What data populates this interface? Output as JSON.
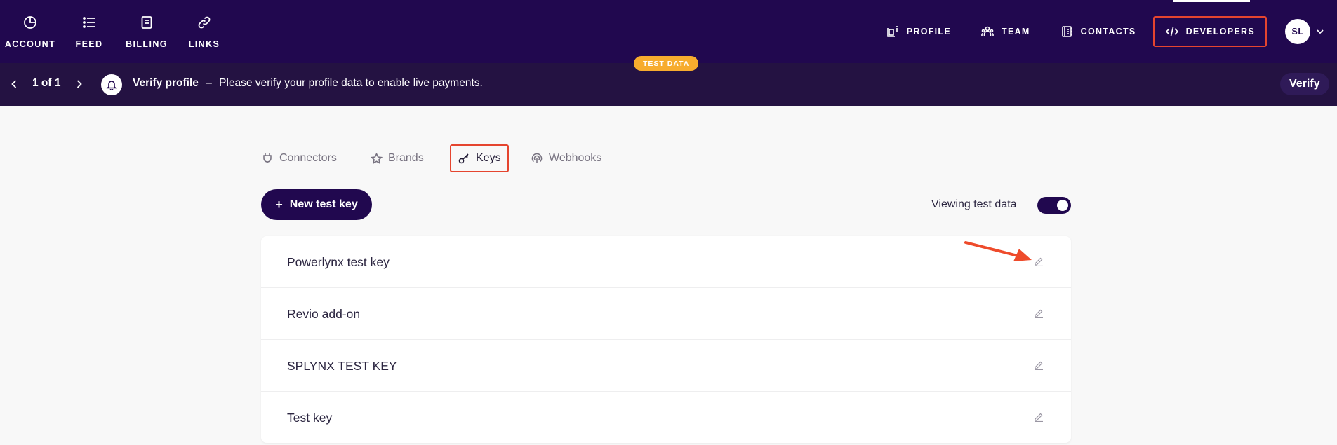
{
  "nav": {
    "left": [
      {
        "label": "ACCOUNT",
        "icon": "pie-chart-icon"
      },
      {
        "label": "FEED",
        "icon": "list-icon"
      },
      {
        "label": "BILLING",
        "icon": "document-icon"
      },
      {
        "label": "LINKS",
        "icon": "link-icon"
      }
    ],
    "right": [
      {
        "label": "PROFILE",
        "icon": "profile-card-icon"
      },
      {
        "label": "TEAM",
        "icon": "team-icon"
      },
      {
        "label": "CONTACTS",
        "icon": "contacts-book-icon"
      },
      {
        "label": "DEVELOPERS",
        "icon": "code-icon"
      }
    ],
    "avatar_initials": "SL"
  },
  "notification": {
    "badge": "TEST DATA",
    "pager": "1 of 1",
    "title": "Verify profile",
    "separator": "–",
    "message": "Please verify your profile data to enable live payments.",
    "verify_label": "Verify"
  },
  "tabs": [
    {
      "label": "Connectors",
      "icon": "plug-icon"
    },
    {
      "label": "Brands",
      "icon": "star-icon"
    },
    {
      "label": "Keys",
      "icon": "key-icon",
      "active": true
    },
    {
      "label": "Webhooks",
      "icon": "webhook-icon"
    }
  ],
  "controls": {
    "new_key_label": "New test key",
    "toggle_label": "Viewing test data",
    "toggle_on": true
  },
  "keys": [
    {
      "name": "Powerlynx test key"
    },
    {
      "name": "Revio add-on"
    },
    {
      "name": "SPLYNX TEST KEY"
    },
    {
      "name": "Test key"
    }
  ],
  "colors": {
    "nav_bg": "#21084f",
    "notification_bg": "#241242",
    "badge": "#f7ac2e",
    "highlight": "#e5452f"
  }
}
